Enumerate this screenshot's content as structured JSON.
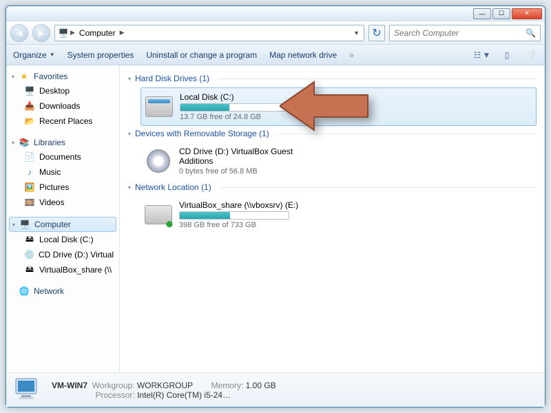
{
  "window": {
    "titlebar_buttons": [
      "minimize",
      "maximize",
      "close"
    ]
  },
  "nav": {
    "crumb_root": "Computer",
    "search_placeholder": "Search Computer"
  },
  "toolbar": {
    "organize": "Organize",
    "properties": "System properties",
    "uninstall": "Uninstall or change a program",
    "mapdrive": "Map network drive"
  },
  "sidebar": {
    "favorites": {
      "label": "Favorites",
      "items": [
        "Desktop",
        "Downloads",
        "Recent Places"
      ]
    },
    "libraries": {
      "label": "Libraries",
      "items": [
        "Documents",
        "Music",
        "Pictures",
        "Videos"
      ]
    },
    "computer": {
      "label": "Computer",
      "items": [
        "Local Disk (C:)",
        "CD Drive (D:) Virtual",
        "VirtualBox_share (\\\\"
      ]
    },
    "network": {
      "label": "Network"
    }
  },
  "groups": {
    "hdd": {
      "title": "Hard Disk Drives (1)",
      "drive": {
        "name": "Local Disk (C:)",
        "free": "13.7 GB free of 24.8 GB",
        "used_pct": 45
      }
    },
    "rem": {
      "title": "Devices with Removable Storage (1)",
      "drive": {
        "name": "CD Drive (D:) VirtualBox Guest Additions",
        "free": "0 bytes free of 56.8 MB"
      }
    },
    "net": {
      "title": "Network Location (1)",
      "drive": {
        "name": "VirtualBox_share (\\\\vboxsrv) (E:)",
        "free": "398 GB free of 733 GB",
        "used_pct": 46
      }
    }
  },
  "status": {
    "computer_name": "VM-WIN7",
    "workgroup_lbl": "Workgroup:",
    "workgroup": "WORKGROUP",
    "memory_lbl": "Memory:",
    "memory": "1.00 GB",
    "processor_lbl": "Processor:",
    "processor": "Intel(R) Core(TM) i5-24…"
  }
}
